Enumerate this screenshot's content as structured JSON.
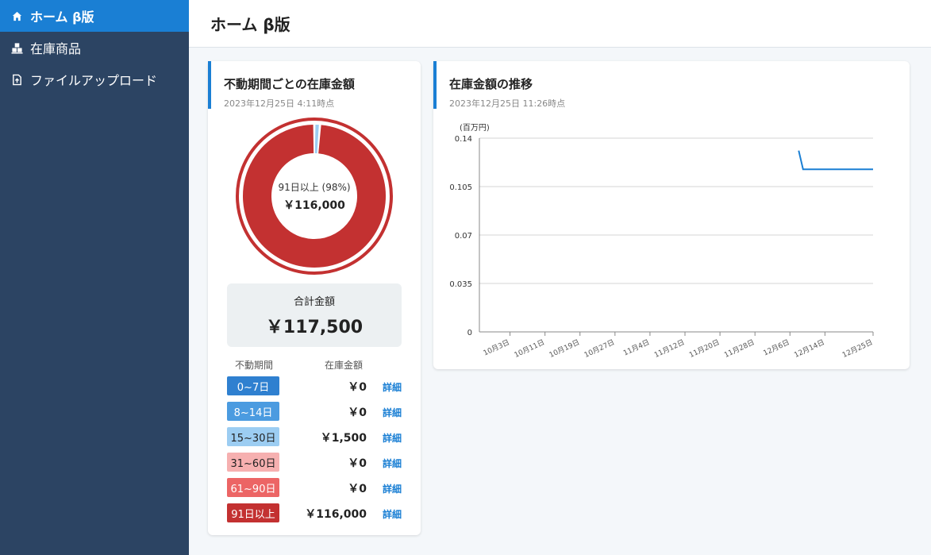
{
  "sidebar": {
    "items": [
      {
        "label": "ホーム β版",
        "icon": "home-icon"
      },
      {
        "label": "在庫商品",
        "icon": "boxes-icon"
      },
      {
        "label": "ファイルアップロード",
        "icon": "file-upload-icon"
      }
    ]
  },
  "header": {
    "title": "ホーム β版"
  },
  "stock_card": {
    "title": "不動期間ごとの在庫金額",
    "timestamp": "2023年12月25日 4:11時点",
    "center_label": "91日以上 (98%)",
    "center_value": "￥116,000",
    "total_label": "合計金額",
    "total_value": "￥117,500",
    "col_period": "不動期間",
    "col_amount": "在庫金額",
    "detail_label": "詳細",
    "rows": [
      {
        "period": "0~7日",
        "amount": "￥0",
        "value": 0,
        "color": "#2f80d0",
        "text_color": "#ffffff"
      },
      {
        "period": "8~14日",
        "amount": "￥0",
        "value": 0,
        "color": "#4b9be0",
        "text_color": "#ffffff"
      },
      {
        "period": "15~30日",
        "amount": "￥1,500",
        "value": 1500,
        "color": "#9ccdf2",
        "text_color": "#222222"
      },
      {
        "period": "31~60日",
        "amount": "￥0",
        "value": 0,
        "color": "#f6b0b0",
        "text_color": "#222222"
      },
      {
        "period": "61~90日",
        "amount": "￥0",
        "value": 0,
        "color": "#ec6565",
        "text_color": "#ffffff"
      },
      {
        "period": "91日以上",
        "amount": "￥116,000",
        "value": 116000,
        "color": "#c33131",
        "text_color": "#ffffff"
      }
    ]
  },
  "trend_card": {
    "title": "在庫金額の推移",
    "timestamp": "2023年12月25日 11:26時点"
  },
  "chart_data": [
    {
      "type": "pie",
      "categories": [
        "0~7日",
        "8~14日",
        "15~30日",
        "31~60日",
        "61~90日",
        "91日以上"
      ],
      "values": [
        0,
        0,
        1500,
        0,
        0,
        116000
      ],
      "colors": [
        "#2f80d0",
        "#4b9be0",
        "#9ccdf2",
        "#f6b0b0",
        "#ec6565",
        "#c33131"
      ]
    },
    {
      "type": "line",
      "ylabel": "(百万円)",
      "ylim": [
        0,
        0.14
      ],
      "yticks": [
        "0",
        "0.035",
        "0.07",
        "0.105",
        "0.14"
      ],
      "ytick_values": [
        0,
        0.035,
        0.07,
        0.105,
        0.14
      ],
      "xlim": [
        "2023-09-26",
        "2023-12-25"
      ],
      "xticks": [
        {
          "label": "10月3日",
          "date": "2023-10-03"
        },
        {
          "label": "10月11日",
          "date": "2023-10-11"
        },
        {
          "label": "10月19日",
          "date": "2023-10-19"
        },
        {
          "label": "10月27日",
          "date": "2023-10-27"
        },
        {
          "label": "11月4日",
          "date": "2023-11-04"
        },
        {
          "label": "11月12日",
          "date": "2023-11-12"
        },
        {
          "label": "11月20日",
          "date": "2023-11-20"
        },
        {
          "label": "11月28日",
          "date": "2023-11-28"
        },
        {
          "label": "12月6日",
          "date": "2023-12-06"
        },
        {
          "label": "12月14日",
          "date": "2023-12-14"
        },
        {
          "label": "12月25日",
          "date": "2023-12-25"
        }
      ],
      "grid": true,
      "color": "#1a7fd4",
      "series": [
        {
          "x": [
            "2023-12-08",
            "2023-12-09",
            "2023-12-25"
          ],
          "values": [
            0.131,
            0.1175,
            0.1175
          ]
        }
      ]
    }
  ]
}
